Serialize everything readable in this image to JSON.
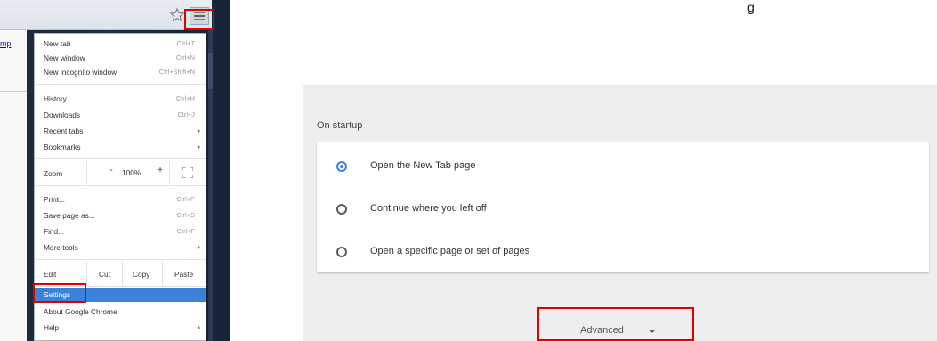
{
  "page_link": "mp",
  "top_fragment": "g",
  "menu": {
    "group1": [
      {
        "label": "New tab",
        "shortcut": "Ctrl+T"
      },
      {
        "label": "New window",
        "shortcut": "Ctrl+N"
      },
      {
        "label": "New incognito window",
        "shortcut": "Ctrl+Shift+N"
      }
    ],
    "group2": [
      {
        "label": "History",
        "shortcut": "Ctrl+H"
      },
      {
        "label": "Downloads",
        "shortcut": "Ctrl+J"
      },
      {
        "label": "Recent tabs",
        "shortcut": ""
      },
      {
        "label": "Bookmarks",
        "shortcut": ""
      }
    ],
    "zoom": {
      "label": "Zoom",
      "minus": "-",
      "value": "100%",
      "plus": "+"
    },
    "group3": [
      {
        "label": "Print...",
        "shortcut": "Ctrl+P"
      },
      {
        "label": "Save page as...",
        "shortcut": "Ctrl+S"
      },
      {
        "label": "Find...",
        "shortcut": "Ctrl+F"
      },
      {
        "label": "More tools",
        "shortcut": ""
      }
    ],
    "edit": {
      "label": "Edit",
      "cut": "Cut",
      "copy": "Copy",
      "paste": "Paste"
    },
    "group4": [
      {
        "label": "Settings"
      },
      {
        "label": "About Google Chrome"
      },
      {
        "label": "Help"
      }
    ]
  },
  "settings": {
    "section_title": "On startup",
    "options": [
      {
        "label": "Open the New Tab page",
        "selected": true
      },
      {
        "label": "Continue where you left off",
        "selected": false
      },
      {
        "label": "Open a specific page or set of pages",
        "selected": false
      }
    ],
    "advanced_label": "Advanced"
  },
  "colors": {
    "highlight_box": "#e00000",
    "menu_selection": "#3b82d8",
    "radio_accent": "#3f7de8"
  }
}
